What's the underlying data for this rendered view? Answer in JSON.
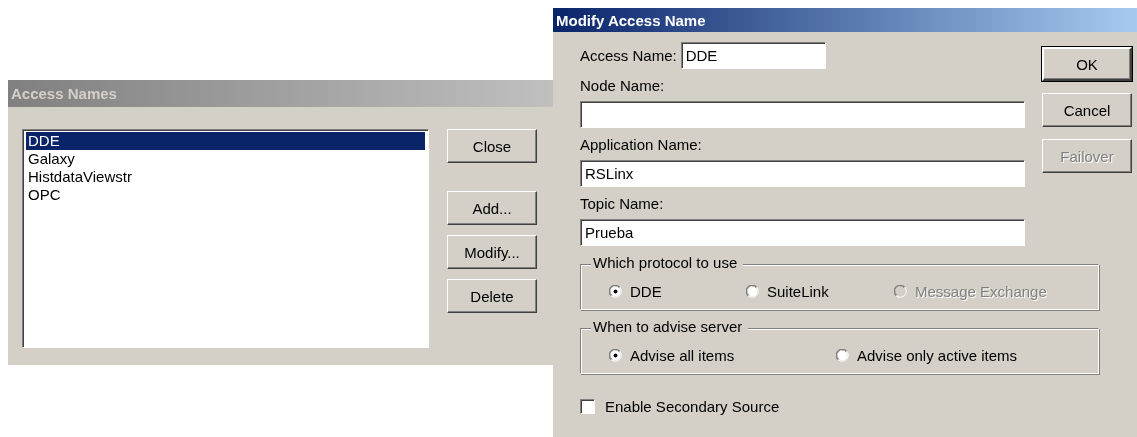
{
  "access_names_window": {
    "title": "Access Names",
    "active": false,
    "list_items": [
      {
        "label": "DDE",
        "selected": true
      },
      {
        "label": "Galaxy",
        "selected": false
      },
      {
        "label": "HistdataViewstr",
        "selected": false
      },
      {
        "label": "OPC",
        "selected": false
      }
    ],
    "buttons": [
      {
        "label": "Close",
        "default": false,
        "disabled": false
      },
      {
        "label": "Add...",
        "default": false,
        "disabled": false
      },
      {
        "label": "Modify...",
        "default": false,
        "disabled": false
      },
      {
        "label": "Delete",
        "default": false,
        "disabled": false
      }
    ]
  },
  "modify_access_name_window": {
    "title": "Modify Access Name",
    "active": true,
    "fields": [
      {
        "label": "Access Name:",
        "value": "DDE",
        "kind": "inline"
      },
      {
        "label": "Node Name:",
        "kind": "stacked"
      },
      {
        "label": "Application Name:",
        "value": "RSLinx",
        "kind": "stacked"
      },
      {
        "label": "Topic Name:",
        "value": "Prueba",
        "kind": "stacked"
      }
    ],
    "buttons": [
      {
        "label": "OK",
        "default": true,
        "disabled": false
      },
      {
        "label": "Cancel",
        "default": false,
        "disabled": false
      },
      {
        "label": "Failover",
        "default": false,
        "disabled": true
      }
    ],
    "protocol_group": {
      "title": "Which protocol to use",
      "options": [
        {
          "label": "DDE",
          "selected": true,
          "disabled": false
        },
        {
          "label": "SuiteLink",
          "selected": false,
          "disabled": false
        },
        {
          "label": "Message Exchange",
          "selected": false,
          "disabled": true
        }
      ]
    },
    "advise_group": {
      "title": "When to advise server",
      "options": [
        {
          "label": "Advise all items",
          "selected": true,
          "disabled": false
        },
        {
          "label": "Advise only active items",
          "selected": false,
          "disabled": false
        }
      ]
    },
    "secondary_source": {
      "label": "Enable Secondary Source",
      "checked": false
    }
  }
}
